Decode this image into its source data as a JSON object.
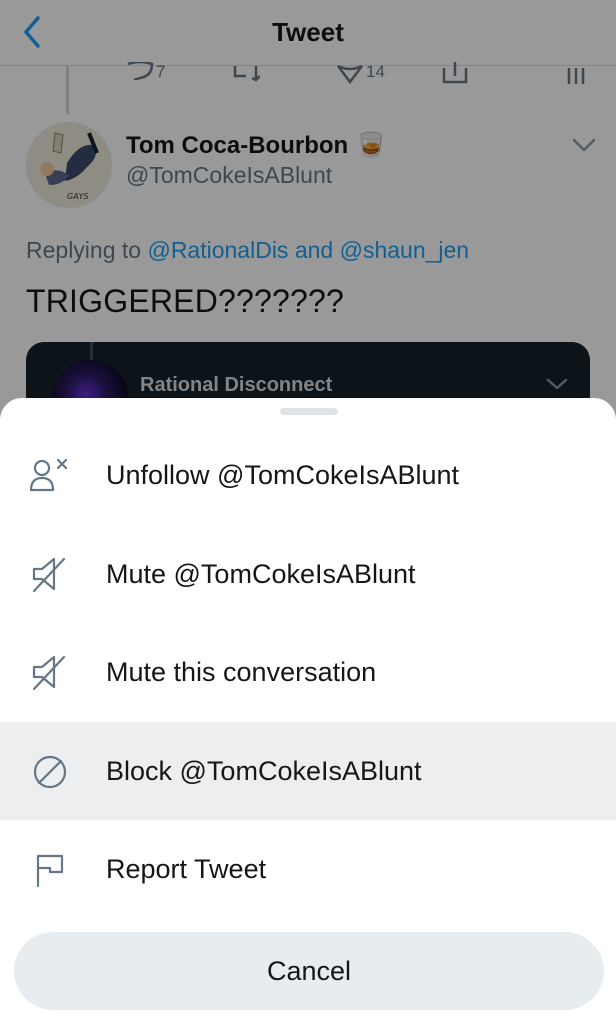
{
  "nav": {
    "title": "Tweet",
    "back_icon": "chevron-left-icon"
  },
  "actions": {
    "like_count": "14",
    "retweet_count": "",
    "reply_count": "7"
  },
  "tweet": {
    "author_name": "Tom Coca-Bourbon",
    "author_emoji": "🥃",
    "author_handle": "@TomCokeIsABlunt",
    "avatar_label": "GAYS",
    "replying_prefix": "Replying to",
    "replying_user1": "@RationalDis",
    "replying_conj": "and",
    "replying_user2": "@shaun_jen",
    "text": "TRIGGERED???????"
  },
  "quoted": {
    "name": "Rational Disconnect"
  },
  "sheet": {
    "items": [
      {
        "label": "Unfollow @TomCokeIsABlunt",
        "icon": "unfollow-icon"
      },
      {
        "label": "Mute @TomCokeIsABlunt",
        "icon": "mute-icon"
      },
      {
        "label": "Mute this conversation",
        "icon": "mute-icon"
      },
      {
        "label": "Block @TomCokeIsABlunt",
        "icon": "block-icon",
        "highlighted": true
      },
      {
        "label": "Report Tweet",
        "icon": "flag-icon"
      }
    ],
    "cancel_label": "Cancel"
  },
  "colors": {
    "accent": "#1da1f2",
    "text": "#14171a",
    "secondary": "#657786",
    "highlight": "#eceef0",
    "cancel_bg": "#e6ecf0"
  }
}
